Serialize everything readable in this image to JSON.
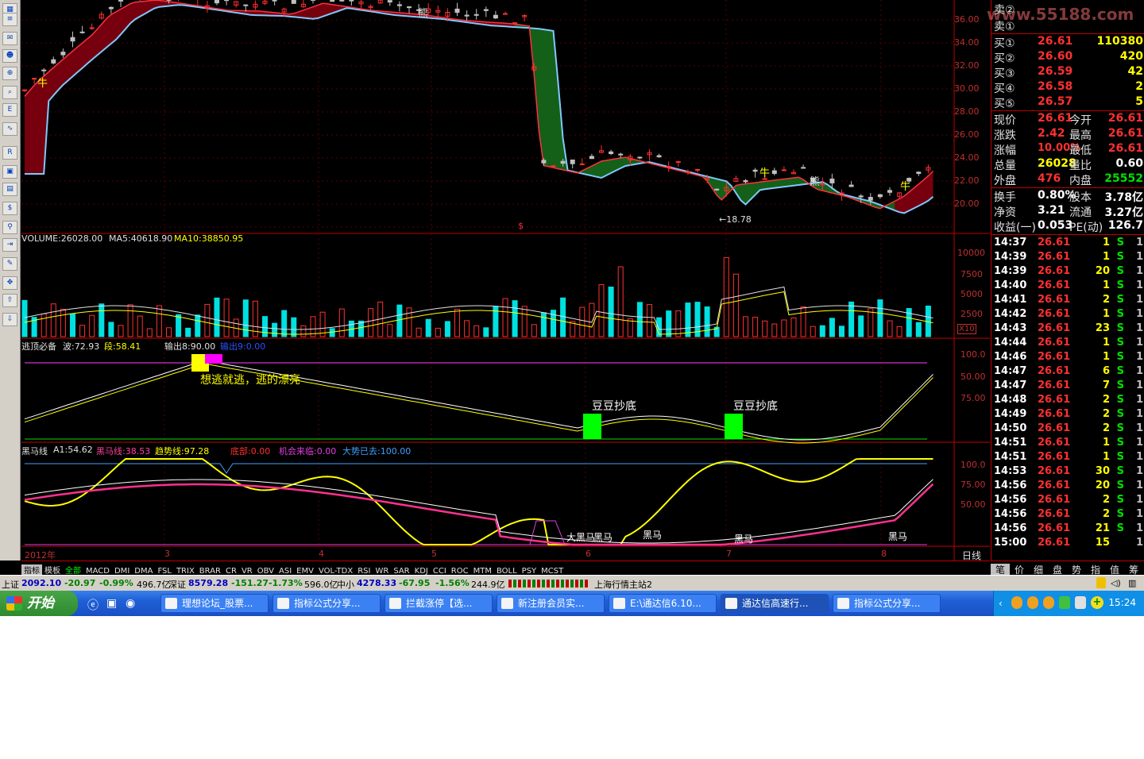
{
  "watermark": "www.55188.com",
  "main_chart": {
    "y_ticks": [
      "36.00",
      "34.00",
      "32.00",
      "30.00",
      "28.00",
      "26.00",
      "24.00",
      "22.00",
      "20.00"
    ],
    "low_marker": "←18.78",
    "labels": {
      "bull_top_left": "牛",
      "bear_top": "熊",
      "bull_mid": "牛",
      "bear_mid": "熊",
      "bull_right": "牛",
      "signal": "$"
    }
  },
  "volume_pane": {
    "title": "VOLUME:26028.00",
    "ma5": "MA5:40618.90",
    "ma10": "MA10:38850.95",
    "y_ticks": [
      "10000",
      "7500",
      "5000",
      "2500"
    ],
    "unit": "X10"
  },
  "escape_pane": {
    "name": "逃顶必备",
    "wave": "波:72.93",
    "segment": "段:58.41",
    "output1": "输出8:90.00",
    "output2": "输出9:0.00",
    "y_ticks": [
      "100.0",
      "75.00",
      "50.00"
    ],
    "msg_escape": "想逃就逃，逃的漂亮",
    "msg_bottom1": "豆豆抄底",
    "msg_bottom2": "豆豆抄底"
  },
  "horse_pane": {
    "name": "黑马线",
    "a1": "A1:54.62",
    "horse": "黑马线:38.53",
    "trend": "趋势线:97.28",
    "bottom": "底部:0.00",
    "chance": "机会来临:0.00",
    "gone": "大势已去:100.00",
    "y_ticks": [
      "100.0",
      "75.00",
      "50.00"
    ],
    "horse_labels": [
      "大黑马",
      "黑马",
      "黑马",
      "黑马",
      "黑马"
    ]
  },
  "x_axis": {
    "year": "2012年",
    "months": [
      "3",
      "4",
      "5",
      "6",
      "7",
      "8"
    ],
    "period": "日线"
  },
  "order_book": {
    "sell_labels": [
      "卖②",
      "卖①"
    ],
    "buy": [
      {
        "label": "买①",
        "price": "26.61",
        "vol": "110380"
      },
      {
        "label": "买②",
        "price": "26.60",
        "vol": "420"
      },
      {
        "label": "买③",
        "price": "26.59",
        "vol": "42"
      },
      {
        "label": "买④",
        "price": "26.58",
        "vol": "2"
      },
      {
        "label": "买⑤",
        "price": "26.57",
        "vol": "5"
      }
    ]
  },
  "quote": [
    {
      "k1": "现价",
      "v1": "26.61",
      "k2": "今开",
      "v2": "26.61"
    },
    {
      "k1": "涨跌",
      "v1": "2.42",
      "k2": "最高",
      "v2": "26.61"
    },
    {
      "k1": "涨幅",
      "v1": "10.00%",
      "k2": "最低",
      "v2": "26.61"
    },
    {
      "k1": "总量",
      "v1": "26028",
      "k2": "量比",
      "v2": "0.60"
    },
    {
      "k1": "外盘",
      "v1": "476",
      "k2": "内盘",
      "v2": "25552"
    },
    {
      "k1": "换手",
      "v1": "0.80%",
      "k2": "股本",
      "v2": "3.78亿"
    },
    {
      "k1": "净资",
      "v1": "3.21",
      "k2": "流通",
      "v2": "3.27亿"
    },
    {
      "k1": "收益(一)",
      "v1": "0.053",
      "k2": "PE(动)",
      "v2": "126.7"
    }
  ],
  "ticks": [
    {
      "t": "14:37",
      "p": "26.61",
      "v": "1",
      "s": "S",
      "n": "1"
    },
    {
      "t": "14:39",
      "p": "26.61",
      "v": "1",
      "s": "S",
      "n": "1"
    },
    {
      "t": "14:39",
      "p": "26.61",
      "v": "20",
      "s": "S",
      "n": "1"
    },
    {
      "t": "14:40",
      "p": "26.61",
      "v": "1",
      "s": "S",
      "n": "1"
    },
    {
      "t": "14:41",
      "p": "26.61",
      "v": "2",
      "s": "S",
      "n": "1"
    },
    {
      "t": "14:42",
      "p": "26.61",
      "v": "1",
      "s": "S",
      "n": "1"
    },
    {
      "t": "14:43",
      "p": "26.61",
      "v": "23",
      "s": "S",
      "n": "1"
    },
    {
      "t": "14:44",
      "p": "26.61",
      "v": "1",
      "s": "S",
      "n": "1"
    },
    {
      "t": "14:46",
      "p": "26.61",
      "v": "1",
      "s": "S",
      "n": "1"
    },
    {
      "t": "14:47",
      "p": "26.61",
      "v": "6",
      "s": "S",
      "n": "1"
    },
    {
      "t": "14:47",
      "p": "26.61",
      "v": "7",
      "s": "S",
      "n": "1"
    },
    {
      "t": "14:48",
      "p": "26.61",
      "v": "2",
      "s": "S",
      "n": "1"
    },
    {
      "t": "14:49",
      "p": "26.61",
      "v": "2",
      "s": "S",
      "n": "1"
    },
    {
      "t": "14:50",
      "p": "26.61",
      "v": "2",
      "s": "S",
      "n": "1"
    },
    {
      "t": "14:51",
      "p": "26.61",
      "v": "1",
      "s": "S",
      "n": "1"
    },
    {
      "t": "14:51",
      "p": "26.61",
      "v": "1",
      "s": "S",
      "n": "1"
    },
    {
      "t": "14:53",
      "p": "26.61",
      "v": "30",
      "s": "S",
      "n": "1"
    },
    {
      "t": "14:56",
      "p": "26.61",
      "v": "20",
      "s": "S",
      "n": "1"
    },
    {
      "t": "14:56",
      "p": "26.61",
      "v": "2",
      "s": "S",
      "n": "1"
    },
    {
      "t": "14:56",
      "p": "26.61",
      "v": "2",
      "s": "S",
      "n": "1"
    },
    {
      "t": "14:56",
      "p": "26.61",
      "v": "21",
      "s": "S",
      "n": "1"
    },
    {
      "t": "15:00",
      "p": "26.61",
      "v": "15",
      "s": "",
      "n": "1"
    }
  ],
  "indicator_tabs": [
    "指标",
    "模板",
    "全部",
    "MACD",
    "DMI",
    "DMA",
    "FSL",
    "TRIX",
    "BRAR",
    "CR",
    "VR",
    "OBV",
    "ASI",
    "EMV",
    "VOL-TDX",
    "RSI",
    "WR",
    "SAR",
    "KDJ",
    "CCI",
    "ROC",
    "MTM",
    "BOLL",
    "PSY",
    "MCST"
  ],
  "right_tabs": [
    "笔",
    "价",
    "细",
    "盘",
    "势",
    "指",
    "值",
    "筹"
  ],
  "status": {
    "sh_label": "上证",
    "sh_value": "2092.10",
    "sh_change": "-20.97",
    "sh_pct": "-0.99%",
    "sh_amount": "496.7亿",
    "sz_label": "深证",
    "sz_value": "8579.28",
    "sz_change": "-151.27",
    "sz_pct": "-1.73%",
    "sz_amount": "596.0亿",
    "sme_label": "中小",
    "sme_value": "4278.33",
    "sme_change": "-67.95",
    "sme_pct": "-1.56%",
    "sme_amount": "244.9亿",
    "server": "上海行情主站2"
  },
  "taskbar": {
    "start": "开始",
    "tasks": [
      "理想论坛_股票...",
      "指标公式分享...",
      "拦截涨停【选...",
      "新注册会员实...",
      "E:\\通达信6.10...",
      "通达信高速行...",
      "指标公式分享..."
    ],
    "clock": "15:24"
  },
  "toolbar_icons": [
    "chart-icon",
    "list-icon",
    "mail-icon",
    "users-icon",
    "zoom-f10-icon",
    "search-icon",
    "etf-icon",
    "line-icon",
    "rsi-icon",
    "photo-icon",
    "calendar-icon",
    "dollar-icon",
    "link-icon",
    "exit-icon",
    "pencil-icon",
    "move-icon",
    "up-arrow-icon",
    "down-arrow-icon"
  ]
}
